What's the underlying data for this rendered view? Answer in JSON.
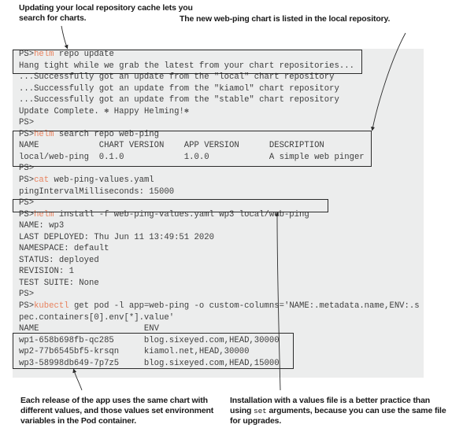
{
  "captions": {
    "top_left": "Updating your local repository cache lets you search for charts.",
    "top_right": "The new web-ping chart is listed in the local repository.",
    "bottom_left": "Each release of the app uses the same chart with different values, and those values set environment variables in the Pod container.",
    "bottom_right_part1": "Installation with a values file is a better practice than using ",
    "bottom_right_mono": "set",
    "bottom_right_part2": " arguments, because you can use the same file for upgrades."
  },
  "colors": {
    "terminal_background": "#eceded",
    "terminal_text": "#3d3d3d",
    "command_keyword": "#e8825e",
    "box_border": "#2b2b2b",
    "caption_text": "#1a1a1a"
  },
  "terminal": {
    "prompt": "PS>",
    "lines": [
      {
        "id": "l01",
        "prompt": "PS>",
        "cmd": "helm",
        "rest": " repo update"
      },
      {
        "id": "l02",
        "text": "Hang tight while we grab the latest from your chart repositories..."
      },
      {
        "id": "l03",
        "text": "...Successfully got an update from the \"local\" chart repository"
      },
      {
        "id": "l04",
        "text": "...Successfully got an update from the \"kiamol\" chart repository"
      },
      {
        "id": "l05",
        "text": "...Successfully got an update from the \"stable\" chart repository"
      },
      {
        "id": "l06",
        "text": "Update Complete. ⎈ Happy Helming!⎈"
      },
      {
        "id": "l07",
        "text": "PS>"
      },
      {
        "id": "l08",
        "prompt": "PS>",
        "cmd": "helm",
        "rest": " search repo web-ping"
      },
      {
        "id": "l09",
        "text": "NAME            CHART VERSION    APP VERSION      DESCRIPTION"
      },
      {
        "id": "l10",
        "text": "local/web-ping  0.1.0            1.0.0            A simple web pinger"
      },
      {
        "id": "l11",
        "text": "PS>"
      },
      {
        "id": "l12",
        "prompt": "PS>",
        "cmd": "cat",
        "rest": " web-ping-values.yaml"
      },
      {
        "id": "l13",
        "text": "pingIntervalMilliseconds: 15000"
      },
      {
        "id": "l14",
        "text": "PS>"
      },
      {
        "id": "l15",
        "prompt": "PS>",
        "cmd": "helm",
        "rest": " install -f web-ping-values.yaml wp3 local/web-ping"
      },
      {
        "id": "l16",
        "text": "NAME: wp3"
      },
      {
        "id": "l17",
        "text": "LAST DEPLOYED: Thu Jun 11 13:49:51 2020"
      },
      {
        "id": "l18",
        "text": "NAMESPACE: default"
      },
      {
        "id": "l19",
        "text": "STATUS: deployed"
      },
      {
        "id": "l20",
        "text": "REVISION: 1"
      },
      {
        "id": "l21",
        "text": "TEST SUITE: None"
      },
      {
        "id": "l22",
        "text": "PS>"
      },
      {
        "id": "l23",
        "prompt": "PS>",
        "cmd": "kubectl",
        "rest": " get pod -l app=web-ping -o custom-columns='NAME:.metadata.name,ENV:.s"
      },
      {
        "id": "l24",
        "text": "pec.containers[0].env[*].value'"
      },
      {
        "id": "l25",
        "text": "NAME                     ENV"
      },
      {
        "id": "l26",
        "text": "wp1-658b698fb-qc285      blog.sixeyed.com,HEAD,30000"
      },
      {
        "id": "l27",
        "text": "wp2-77b6545bf5-krsqn     kiamol.net,HEAD,30000"
      },
      {
        "id": "l28",
        "text": "wp3-58998db649-7p7z5     blog.sixeyed.com,HEAD,15000"
      }
    ]
  }
}
